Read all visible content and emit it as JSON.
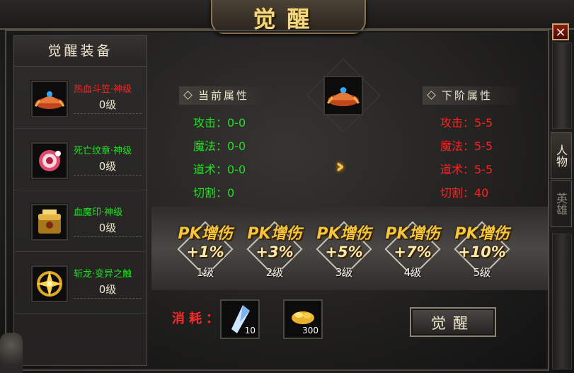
{
  "window": {
    "title": "觉醒",
    "close_label": "✕"
  },
  "left_panel": {
    "title": "觉醒装备",
    "items": [
      {
        "name": "热血斗笠·神级",
        "level": "0级",
        "name_color": "red",
        "icon": "helmet-icon"
      },
      {
        "name": "死亡纹章·神级",
        "level": "0级",
        "name_color": "green",
        "icon": "emblem-icon"
      },
      {
        "name": "血魔印·神级",
        "level": "0级",
        "name_color": "green",
        "icon": "seal-chest-icon"
      },
      {
        "name": "斩龙·变异之触",
        "level": "0级",
        "name_color": "green",
        "icon": "star-medal-icon"
      }
    ]
  },
  "tabs": [
    {
      "label": "人物",
      "active": true
    },
    {
      "label": "英雄",
      "active": false
    }
  ],
  "current_attrs": {
    "header": "当前属性",
    "rows": [
      "攻击：0-0",
      "魔法：0-0",
      "道术：0-0",
      "切割：0"
    ]
  },
  "next_attrs": {
    "header": "下阶属性",
    "rows": [
      "攻击：5-5",
      "魔法：5-5",
      "道术：5-5",
      "切割：40"
    ]
  },
  "pk_levels": [
    {
      "title": "PK增伤",
      "bonus": "+1%",
      "level": "1级"
    },
    {
      "title": "PK增伤",
      "bonus": "+3%",
      "level": "2级"
    },
    {
      "title": "PK增伤",
      "bonus": "+5%",
      "level": "3级"
    },
    {
      "title": "PK增伤",
      "bonus": "+7%",
      "level": "4级"
    },
    {
      "title": "PK增伤",
      "bonus": "+10%",
      "level": "5级"
    }
  ],
  "cost": {
    "label": "消耗：",
    "items": [
      {
        "icon": "crystal-shard-icon",
        "qty": "10"
      },
      {
        "icon": "gold-ingot-icon",
        "qty": "300"
      }
    ]
  },
  "awaken_button": "觉醒",
  "colors": {
    "accent_gold": "#f5c53a",
    "current_green": "#1ee31e",
    "next_red": "#ff2020"
  }
}
